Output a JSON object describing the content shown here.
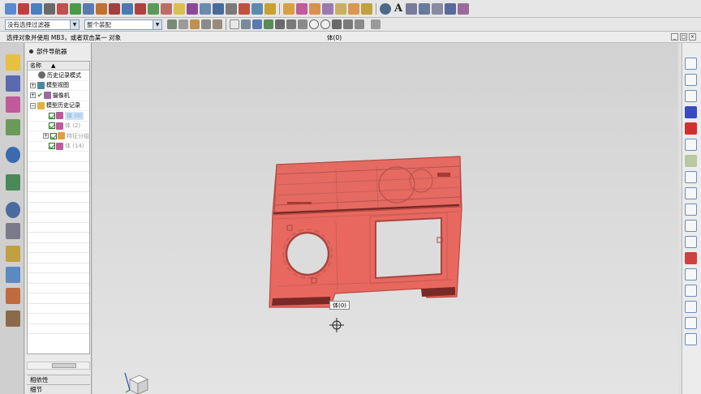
{
  "toolbar": {
    "filter_combo": "没有选择过滤器",
    "scope_combo": "整个装配"
  },
  "status_bar": {
    "prompt": "选择对象并使用 MB3，或者双击某一 对象",
    "message": "体(0)"
  },
  "part_navigator": {
    "title": "部件导航器",
    "column_header": "名称",
    "items": [
      {
        "label": "历史记录模式"
      },
      {
        "label": "模型视图"
      },
      {
        "label": "摄像机"
      },
      {
        "label": "模型历史记录"
      },
      {
        "label": "体 (0)",
        "selected": true
      },
      {
        "label": "体 (2)"
      },
      {
        "label": "特征分组"
      },
      {
        "label": "体 (14)"
      }
    ],
    "sections": [
      "相依性",
      "细节"
    ]
  },
  "graphics": {
    "tooltip": "体(0)",
    "model_color": "#e8685f",
    "background": "#dcdcdc"
  }
}
